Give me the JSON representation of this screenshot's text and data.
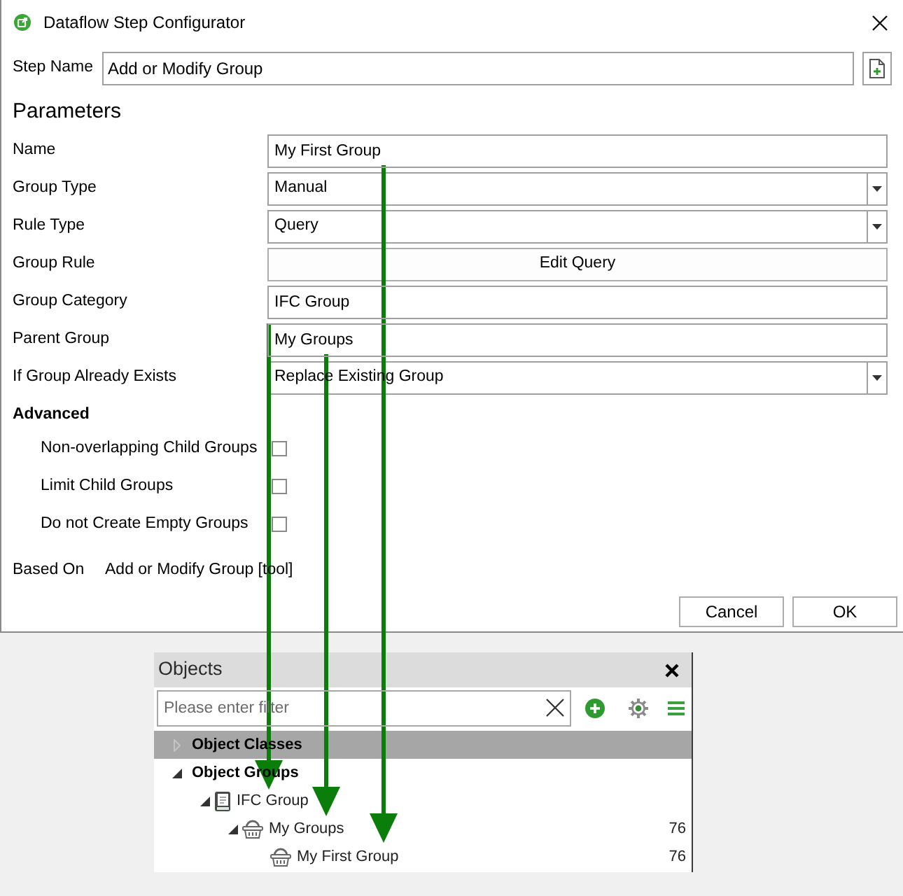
{
  "window": {
    "title": "Dataflow Step Configurator"
  },
  "step_name": {
    "label": "Step Name",
    "value": "Add or Modify Group"
  },
  "parameters": {
    "heading": "Parameters",
    "fields": [
      {
        "label": "Name",
        "kind": "text",
        "value": "My First Group"
      },
      {
        "label": "Group Type",
        "kind": "dropdown",
        "value": "Manual"
      },
      {
        "label": "Rule Type",
        "kind": "dropdown",
        "value": "Query"
      },
      {
        "label": "Group Rule",
        "kind": "button",
        "value": "Edit Query"
      },
      {
        "label": "Group Category",
        "kind": "text",
        "value": "IFC Group"
      },
      {
        "label": "Parent Group",
        "kind": "text",
        "value": "My Groups"
      },
      {
        "label": "If Group Already Exists",
        "kind": "dropdown",
        "value": "Replace Existing Group"
      }
    ]
  },
  "advanced": {
    "heading": "Advanced",
    "options": [
      {
        "label": "Non-overlapping Child Groups",
        "checked": false
      },
      {
        "label": "Limit Child Groups",
        "checked": false
      },
      {
        "label": "Do not Create Empty Groups",
        "checked": false
      }
    ]
  },
  "based_on": {
    "label": "Based On",
    "value": "Add or Modify Group [tool]"
  },
  "buttons": [
    {
      "label": "Cancel"
    },
    {
      "label": "OK"
    }
  ],
  "objects_panel": {
    "title": "Objects",
    "filter": {
      "placeholder": "Please enter filter"
    },
    "tree": [
      {
        "label": "Object Classes",
        "selected": true,
        "expanded": false
      },
      {
        "label": "Object Groups",
        "selected": false,
        "expanded": true,
        "children": [
          {
            "label": "IFC Group",
            "kind": "category",
            "selected": false,
            "expanded": true,
            "children": [
              {
                "label": "My Groups",
                "kind": "group",
                "selected": false,
                "expanded": true,
                "count": "76",
                "children": [
                  {
                    "label": "My First Group",
                    "kind": "group",
                    "selected": false,
                    "count": "76"
                  }
                ]
              }
            ]
          }
        ]
      }
    ]
  }
}
